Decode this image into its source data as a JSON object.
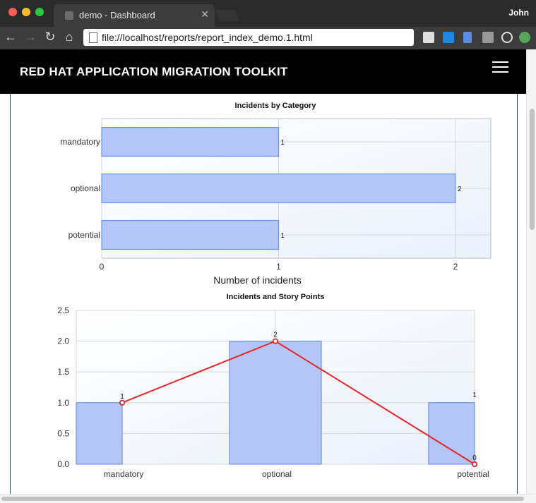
{
  "browser": {
    "tab_title": "demo - Dashboard",
    "user": "John",
    "url": "file://localhost/reports/report_index_demo.1.html"
  },
  "app": {
    "brand": "RED HAT APPLICATION MIGRATION TOOLKIT"
  },
  "colors": {
    "bar_fill": "#b3c6f7",
    "bar_stroke": "#6f93e6",
    "line": "#e6262b"
  },
  "chart_data": [
    {
      "type": "bar",
      "orientation": "horizontal",
      "title": "Incidents by Category",
      "categories": [
        "mandatory",
        "optional",
        "potential"
      ],
      "values": [
        1,
        2,
        1
      ],
      "xlabel": "Number of incidents",
      "xlim": [
        0,
        2.2
      ],
      "xticks": [
        "0",
        "1",
        "2"
      ],
      "data_labels": [
        "1",
        "2",
        "1"
      ],
      "grid": true
    },
    {
      "type": "bar+line",
      "title": "Incidents and Story Points",
      "categories": [
        "mandatory",
        "optional",
        "potential"
      ],
      "series": [
        {
          "type": "bar",
          "values": [
            1,
            2,
            1
          ]
        },
        {
          "type": "line",
          "values": [
            1,
            2,
            0
          ]
        }
      ],
      "ylim": [
        0,
        2.5
      ],
      "yticks": [
        "0.0",
        "0.5",
        "1.0",
        "1.5",
        "2.0",
        "2.5"
      ],
      "bar_labels": [
        "",
        "",
        "1"
      ],
      "line_labels": [
        "1",
        "2",
        "0"
      ],
      "grid": true
    }
  ]
}
